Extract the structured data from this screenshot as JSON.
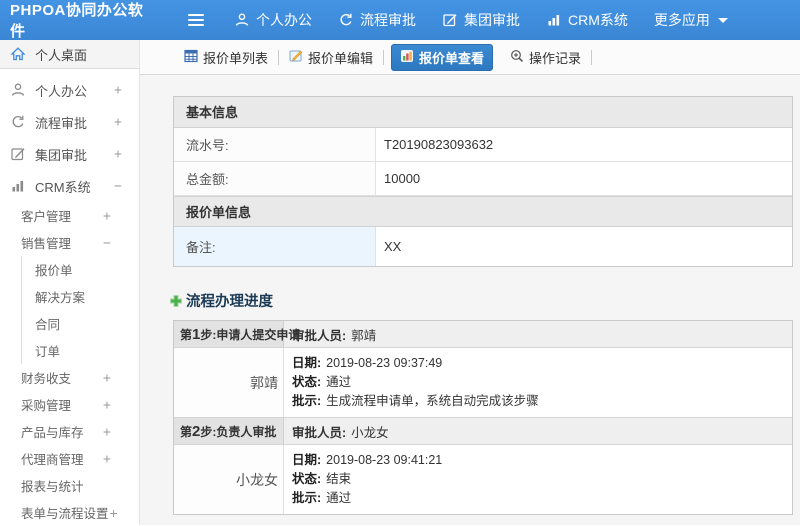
{
  "topbar": {
    "brand": "PHPOA协同办公软件",
    "nav": [
      {
        "label": "个人办公",
        "icon": "user-icon"
      },
      {
        "label": "流程审批",
        "icon": "cycle-icon"
      },
      {
        "label": "集团审批",
        "icon": "edit-icon"
      },
      {
        "label": "CRM系统",
        "icon": "bar-chart-icon"
      },
      {
        "label": "更多应用",
        "icon": "caret-down-icon"
      }
    ]
  },
  "sidebar": {
    "items": [
      {
        "label": "个人桌面",
        "icon": "home-icon"
      },
      {
        "label": "个人办公",
        "icon": "user-icon",
        "expander": "+"
      },
      {
        "label": "流程审批",
        "icon": "cycle-icon",
        "expander": "+"
      },
      {
        "label": "集团审批",
        "icon": "edit-icon",
        "expander": "+"
      },
      {
        "label": "CRM系统",
        "icon": "bar-chart-icon",
        "expander": "−"
      },
      {
        "label": "客户管理",
        "expander": "+"
      },
      {
        "label": "销售管理",
        "expander": "−"
      },
      {
        "label": "报价单"
      },
      {
        "label": "解决方案"
      },
      {
        "label": "合同"
      },
      {
        "label": "订单"
      },
      {
        "label": "财务收支",
        "expander": "+"
      },
      {
        "label": "采购管理",
        "expander": "+"
      },
      {
        "label": "产品与库存",
        "expander": "+"
      },
      {
        "label": "代理商管理",
        "expander": "+"
      },
      {
        "label": "报表与统计"
      },
      {
        "label": "表单与流程设置",
        "expander": "+"
      }
    ]
  },
  "tabbar": {
    "tabs": [
      {
        "label": "报价单列表",
        "icon": "table-list-icon",
        "active": false
      },
      {
        "label": "报价单编辑",
        "icon": "edit-doc-icon",
        "active": false
      },
      {
        "label": "报价单查看",
        "icon": "view-chart-icon",
        "active": true
      },
      {
        "label": "操作记录",
        "icon": "zoom-in-icon",
        "active": false
      }
    ]
  },
  "form": {
    "sections": [
      {
        "title": "基本信息",
        "rows": [
          {
            "label": "流水号:",
            "value": "T20190823093632"
          },
          {
            "label": "总金额:",
            "value": "10000"
          }
        ]
      },
      {
        "title": "报价单信息",
        "rows": [
          {
            "label": "备注:",
            "value": "XX"
          }
        ]
      }
    ]
  },
  "progress": {
    "title": "流程办理进度",
    "approver_label": "审批人员:",
    "date_label": "日期:",
    "status_label": "状态:",
    "comment_label": "批示:",
    "steps": [
      {
        "step_prefix": "第",
        "step_num": "1",
        "step_suffix": "步:申请人提交申请",
        "approver": "郭靖",
        "name": "郭靖",
        "date": "2019-08-23 09:37:49",
        "status": "通过",
        "comment": "生成流程申请单，系统自动完成该步骤"
      },
      {
        "step_prefix": "第",
        "step_num": "2",
        "step_suffix": "步:负责人审批",
        "approver": "小龙女",
        "name": "小龙女",
        "date": "2019-08-23 09:41:21",
        "status": "结束",
        "comment": "通过"
      }
    ]
  },
  "colors": {
    "topbar_blue": "#3d8cdc",
    "active_tab_blue": "#2d78c0",
    "remark_label_bg": "#eaf5fd",
    "accent_green": "#4eb14e"
  }
}
